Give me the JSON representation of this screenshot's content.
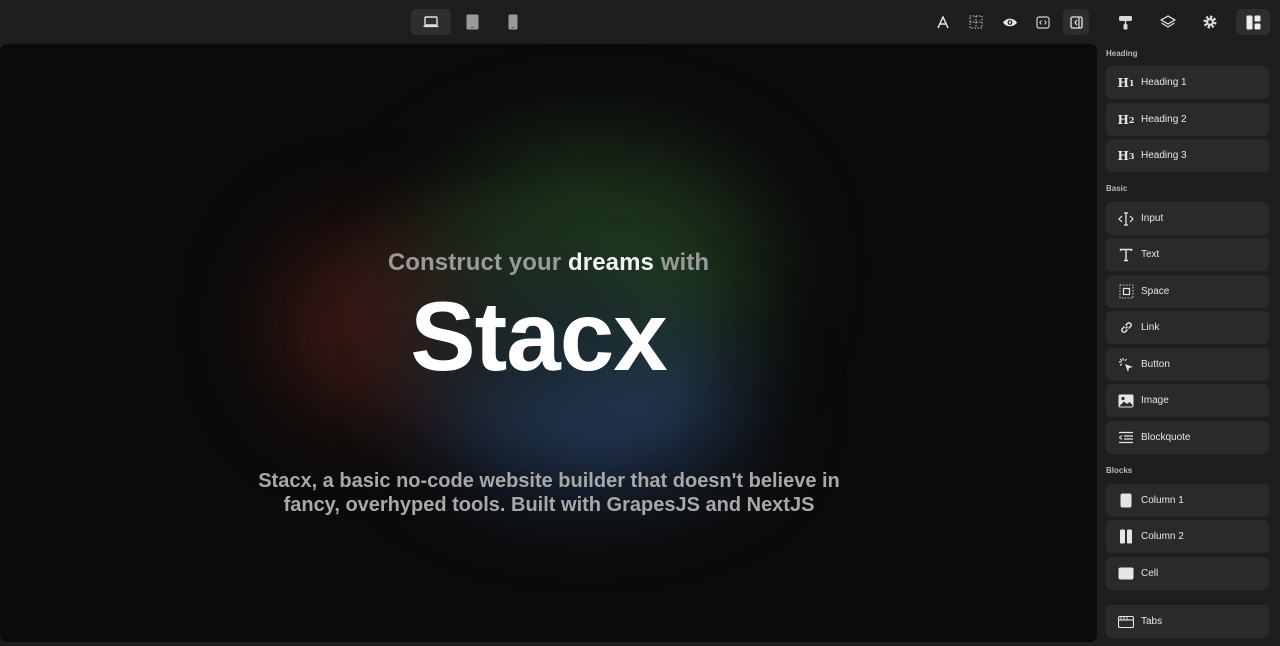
{
  "toolbar": {
    "devices": [
      "desktop-icon",
      "tablet-icon",
      "mobile-icon"
    ],
    "actions": [
      "text-style-icon",
      "outline-icon",
      "preview-icon",
      "code-icon",
      "sidebar-toggle-icon"
    ],
    "panels": [
      "style-manager-icon",
      "layers-icon",
      "settings-icon",
      "blocks-icon"
    ]
  },
  "hero": {
    "sub_pre": "Construct your",
    "sub_strong": "dreams",
    "sub_post": "with",
    "title": "Stacx",
    "desc": "Stacx, a basic no-code website builder that doesn't believe in fancy, overhyped tools. Built with GrapesJS and NextJS"
  },
  "panel": {
    "sections": [
      {
        "label": "Heading",
        "items": [
          {
            "label": "Heading 1",
            "icon": "heading-1-icon",
            "glyph": "H",
            "sub": "1"
          },
          {
            "label": "Heading 2",
            "icon": "heading-2-icon",
            "glyph": "H",
            "sub": "2"
          },
          {
            "label": "Heading 3",
            "icon": "heading-3-icon",
            "glyph": "H",
            "sub": "3"
          }
        ]
      },
      {
        "label": "Basic",
        "items": [
          {
            "label": "Input",
            "icon": "input-icon"
          },
          {
            "label": "Text",
            "icon": "text-icon"
          },
          {
            "label": "Space",
            "icon": "space-icon"
          },
          {
            "label": "Link",
            "icon": "link-icon"
          },
          {
            "label": "Button",
            "icon": "button-icon"
          },
          {
            "label": "Image",
            "icon": "image-icon"
          },
          {
            "label": "Blockquote",
            "icon": "blockquote-icon"
          }
        ]
      },
      {
        "label": "Blocks",
        "items": [
          {
            "label": "Column 1",
            "icon": "column-1-icon"
          },
          {
            "label": "Column 2",
            "icon": "column-2-icon"
          },
          {
            "label": "Cell",
            "icon": "cell-icon"
          }
        ]
      },
      {
        "label": "",
        "items": [
          {
            "label": "Tabs",
            "icon": "tabs-icon"
          }
        ]
      }
    ]
  }
}
